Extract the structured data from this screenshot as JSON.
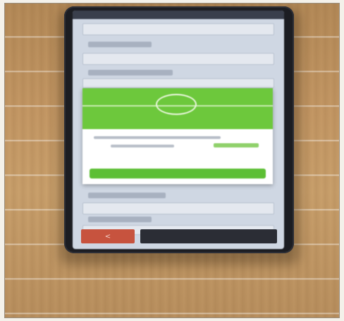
{
  "photo": {
    "subject": "smartphone-on-wooden-surface",
    "colors": {
      "wood": "#c49865",
      "phone_body": "#1c1d22",
      "dialog_green": "#6dc83c",
      "back_button": "#c7533e"
    }
  },
  "screen": {
    "status_bar": {
      "time": "",
      "icons": ""
    },
    "dialog": {
      "title": "",
      "message": "",
      "action": "",
      "confirm": ""
    },
    "bottom_bar": {
      "back_label": "<",
      "next_label": ""
    }
  }
}
